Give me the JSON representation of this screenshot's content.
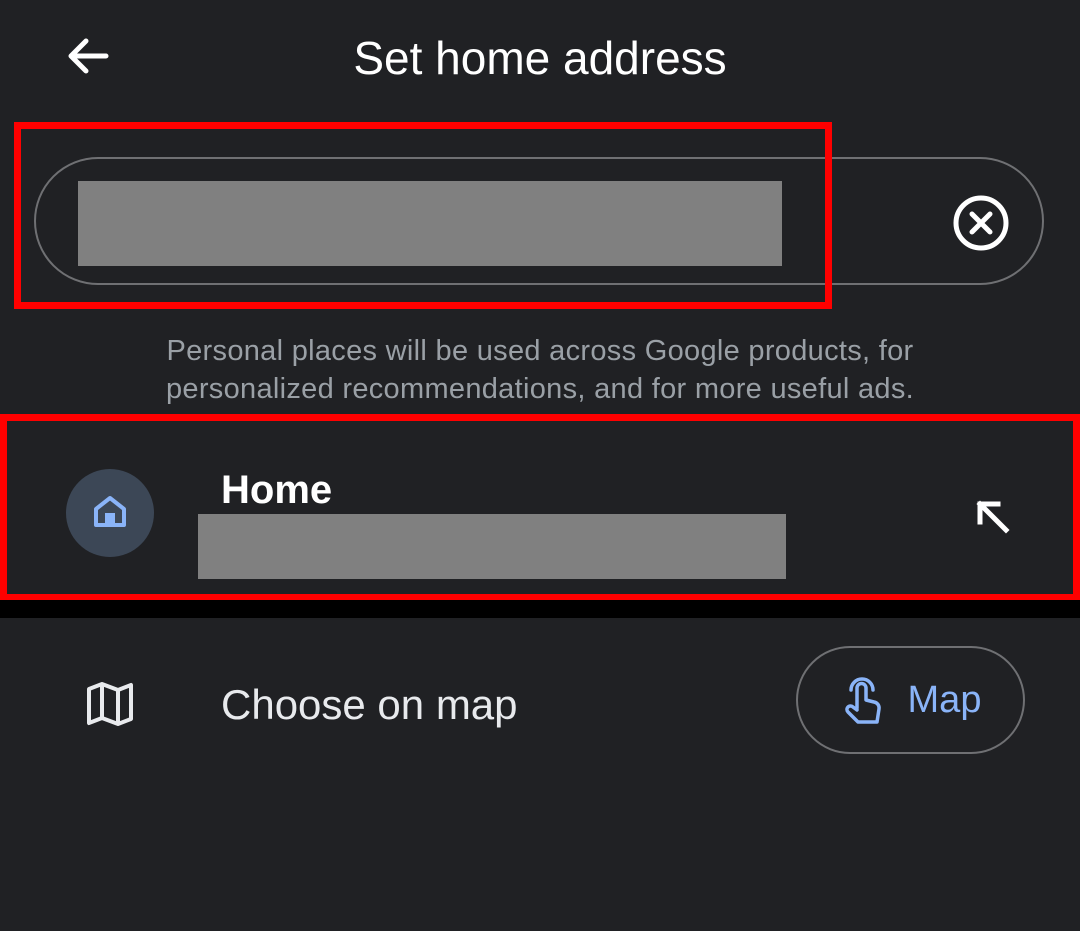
{
  "header": {
    "title": "Set home address"
  },
  "search": {
    "value": "",
    "placeholder": ""
  },
  "disclaimer": {
    "line1": "Personal places will be used across Google products, for",
    "line2": "personalized recommendations, and for more useful ads."
  },
  "suggestion": {
    "label": "Home",
    "address": ""
  },
  "map_option": {
    "label": "Choose on map",
    "button_label": "Map"
  },
  "icons": {
    "back": "arrow-back-icon",
    "clear": "clear-circle-icon",
    "home": "home-icon",
    "fill": "arrow-up-left-icon",
    "map": "map-icon",
    "touch": "touch-hand-icon"
  },
  "colors": {
    "background": "#202124",
    "accent": "#8ab4f8",
    "highlight": "#ff0000",
    "redacted": "#808080",
    "icon_circle": "#3c4756"
  }
}
